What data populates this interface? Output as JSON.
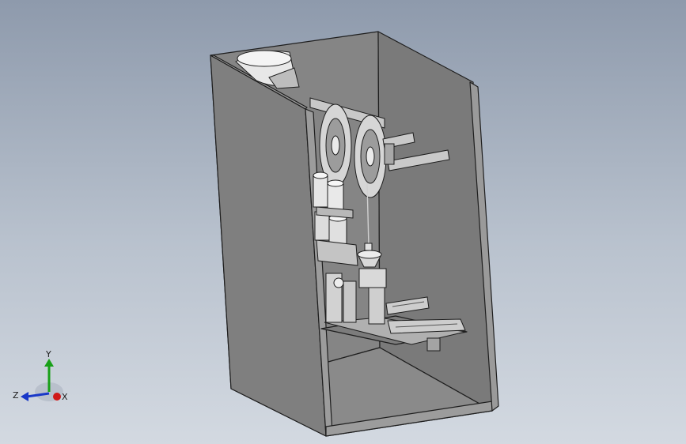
{
  "viewport": {
    "background_top": "#8e9aac",
    "background_bottom": "#d3d9e1"
  },
  "model": {
    "body_color": "#808080",
    "edge_color": "#1e1e1e",
    "component_color": "#c8c8c8"
  },
  "triad": {
    "x_label": "X",
    "y_label": "Y",
    "z_label": "Z",
    "x_color": "#d01818",
    "y_color": "#18a018",
    "z_color": "#1838c8"
  }
}
